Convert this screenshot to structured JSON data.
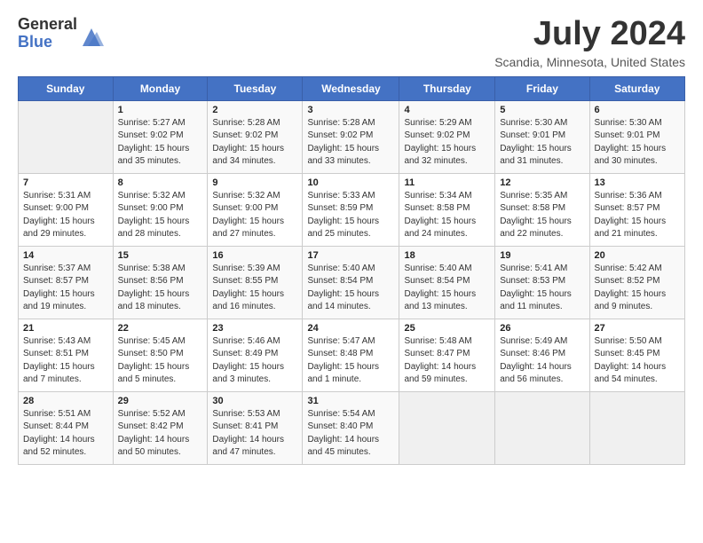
{
  "header": {
    "logo_general": "General",
    "logo_blue": "Blue",
    "month_title": "July 2024",
    "subtitle": "Scandia, Minnesota, United States"
  },
  "weekdays": [
    "Sunday",
    "Monday",
    "Tuesday",
    "Wednesday",
    "Thursday",
    "Friday",
    "Saturday"
  ],
  "weeks": [
    [
      {
        "day": "",
        "info": ""
      },
      {
        "day": "1",
        "info": "Sunrise: 5:27 AM\nSunset: 9:02 PM\nDaylight: 15 hours\nand 35 minutes."
      },
      {
        "day": "2",
        "info": "Sunrise: 5:28 AM\nSunset: 9:02 PM\nDaylight: 15 hours\nand 34 minutes."
      },
      {
        "day": "3",
        "info": "Sunrise: 5:28 AM\nSunset: 9:02 PM\nDaylight: 15 hours\nand 33 minutes."
      },
      {
        "day": "4",
        "info": "Sunrise: 5:29 AM\nSunset: 9:02 PM\nDaylight: 15 hours\nand 32 minutes."
      },
      {
        "day": "5",
        "info": "Sunrise: 5:30 AM\nSunset: 9:01 PM\nDaylight: 15 hours\nand 31 minutes."
      },
      {
        "day": "6",
        "info": "Sunrise: 5:30 AM\nSunset: 9:01 PM\nDaylight: 15 hours\nand 30 minutes."
      }
    ],
    [
      {
        "day": "7",
        "info": "Sunrise: 5:31 AM\nSunset: 9:00 PM\nDaylight: 15 hours\nand 29 minutes."
      },
      {
        "day": "8",
        "info": "Sunrise: 5:32 AM\nSunset: 9:00 PM\nDaylight: 15 hours\nand 28 minutes."
      },
      {
        "day": "9",
        "info": "Sunrise: 5:32 AM\nSunset: 9:00 PM\nDaylight: 15 hours\nand 27 minutes."
      },
      {
        "day": "10",
        "info": "Sunrise: 5:33 AM\nSunset: 8:59 PM\nDaylight: 15 hours\nand 25 minutes."
      },
      {
        "day": "11",
        "info": "Sunrise: 5:34 AM\nSunset: 8:58 PM\nDaylight: 15 hours\nand 24 minutes."
      },
      {
        "day": "12",
        "info": "Sunrise: 5:35 AM\nSunset: 8:58 PM\nDaylight: 15 hours\nand 22 minutes."
      },
      {
        "day": "13",
        "info": "Sunrise: 5:36 AM\nSunset: 8:57 PM\nDaylight: 15 hours\nand 21 minutes."
      }
    ],
    [
      {
        "day": "14",
        "info": "Sunrise: 5:37 AM\nSunset: 8:57 PM\nDaylight: 15 hours\nand 19 minutes."
      },
      {
        "day": "15",
        "info": "Sunrise: 5:38 AM\nSunset: 8:56 PM\nDaylight: 15 hours\nand 18 minutes."
      },
      {
        "day": "16",
        "info": "Sunrise: 5:39 AM\nSunset: 8:55 PM\nDaylight: 15 hours\nand 16 minutes."
      },
      {
        "day": "17",
        "info": "Sunrise: 5:40 AM\nSunset: 8:54 PM\nDaylight: 15 hours\nand 14 minutes."
      },
      {
        "day": "18",
        "info": "Sunrise: 5:40 AM\nSunset: 8:54 PM\nDaylight: 15 hours\nand 13 minutes."
      },
      {
        "day": "19",
        "info": "Sunrise: 5:41 AM\nSunset: 8:53 PM\nDaylight: 15 hours\nand 11 minutes."
      },
      {
        "day": "20",
        "info": "Sunrise: 5:42 AM\nSunset: 8:52 PM\nDaylight: 15 hours\nand 9 minutes."
      }
    ],
    [
      {
        "day": "21",
        "info": "Sunrise: 5:43 AM\nSunset: 8:51 PM\nDaylight: 15 hours\nand 7 minutes."
      },
      {
        "day": "22",
        "info": "Sunrise: 5:45 AM\nSunset: 8:50 PM\nDaylight: 15 hours\nand 5 minutes."
      },
      {
        "day": "23",
        "info": "Sunrise: 5:46 AM\nSunset: 8:49 PM\nDaylight: 15 hours\nand 3 minutes."
      },
      {
        "day": "24",
        "info": "Sunrise: 5:47 AM\nSunset: 8:48 PM\nDaylight: 15 hours\nand 1 minute."
      },
      {
        "day": "25",
        "info": "Sunrise: 5:48 AM\nSunset: 8:47 PM\nDaylight: 14 hours\nand 59 minutes."
      },
      {
        "day": "26",
        "info": "Sunrise: 5:49 AM\nSunset: 8:46 PM\nDaylight: 14 hours\nand 56 minutes."
      },
      {
        "day": "27",
        "info": "Sunrise: 5:50 AM\nSunset: 8:45 PM\nDaylight: 14 hours\nand 54 minutes."
      }
    ],
    [
      {
        "day": "28",
        "info": "Sunrise: 5:51 AM\nSunset: 8:44 PM\nDaylight: 14 hours\nand 52 minutes."
      },
      {
        "day": "29",
        "info": "Sunrise: 5:52 AM\nSunset: 8:42 PM\nDaylight: 14 hours\nand 50 minutes."
      },
      {
        "day": "30",
        "info": "Sunrise: 5:53 AM\nSunset: 8:41 PM\nDaylight: 14 hours\nand 47 minutes."
      },
      {
        "day": "31",
        "info": "Sunrise: 5:54 AM\nSunset: 8:40 PM\nDaylight: 14 hours\nand 45 minutes."
      },
      {
        "day": "",
        "info": ""
      },
      {
        "day": "",
        "info": ""
      },
      {
        "day": "",
        "info": ""
      }
    ]
  ]
}
